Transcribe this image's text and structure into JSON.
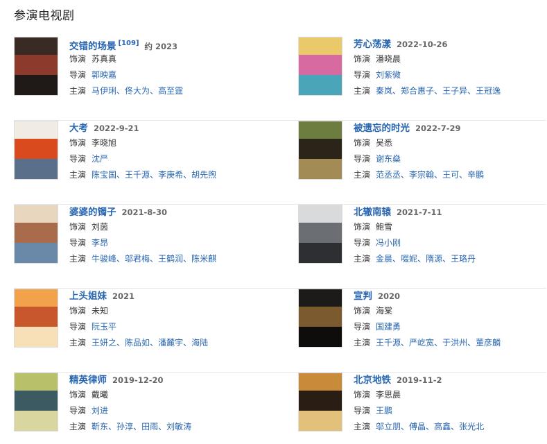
{
  "section_title": "参演电视剧",
  "labels": {
    "role": "饰演",
    "director": "导演",
    "cast": "主演"
  },
  "shows": [
    {
      "title": "交错的场景",
      "ref": "[109]",
      "date": "约 2023",
      "role": "苏真真",
      "director": "郭映嘉",
      "cast": [
        "马伊琍",
        "佟大为",
        "高至霆"
      ],
      "poster_colors": [
        "#3a2a24",
        "#8b3a2c",
        "#1f1a18"
      ]
    },
    {
      "title": "芳心荡漾",
      "ref": "",
      "date": "2022-10-26",
      "role": "潘晓晨",
      "director": "刘紫微",
      "cast": [
        "秦岚",
        "郑合惠子",
        "王子异",
        "王冠逸"
      ],
      "poster_colors": [
        "#e9c96a",
        "#d76aa0",
        "#4aa5b8"
      ]
    },
    {
      "title": "大考",
      "ref": "",
      "date": "2022-9-21",
      "role": "李晓旭",
      "director": "沈严",
      "cast": [
        "陈宝国",
        "王千源",
        "李庚希",
        "胡先煦"
      ],
      "poster_colors": [
        "#f0ece4",
        "#d94a1e",
        "#5a6f8a"
      ]
    },
    {
      "title": "被遗忘的时光",
      "ref": "",
      "date": "2022-7-29",
      "role": "吴悉",
      "director": "谢东燊",
      "cast": [
        "范丞丞",
        "李宗翰",
        "王可",
        "辛鹏"
      ],
      "poster_colors": [
        "#6d7c3f",
        "#2b2418",
        "#a38b55"
      ]
    },
    {
      "title": "婆婆的镯子",
      "ref": "",
      "date": "2021-8-30",
      "role": "刘茵",
      "director": "李昂",
      "cast": [
        "牛骏峰",
        "邬君梅",
        "王鹤润",
        "陈米麒"
      ],
      "poster_colors": [
        "#e8d6bf",
        "#a86b4b",
        "#6a88a8"
      ]
    },
    {
      "title": "北辙南辕",
      "ref": "",
      "date": "2021-7-11",
      "role": "鲍雪",
      "director": "冯小刚",
      "cast": [
        "金晨",
        "啜妮",
        "隋源",
        "王珞丹"
      ],
      "poster_colors": [
        "#d9dadb",
        "#6b6e73",
        "#2e2f33"
      ]
    },
    {
      "title": "上头姐妹",
      "ref": "",
      "date": "2021",
      "role": "未知",
      "director": "阮玉平",
      "cast": [
        "王妍之",
        "陈品如",
        "潘麓宇",
        "海陆"
      ],
      "poster_colors": [
        "#f2a24a",
        "#c9572c",
        "#f7e0b8"
      ]
    },
    {
      "title": "宣判",
      "ref": "",
      "date": "2020",
      "role": "海棠",
      "director": "国建勇",
      "cast": [
        "王千源",
        "严屹宽",
        "于洪州",
        "董彦麟"
      ],
      "poster_colors": [
        "#1c1b19",
        "#7a5a2e",
        "#0e0d0c"
      ]
    },
    {
      "title": "精英律师",
      "ref": "",
      "date": "2019-12-20",
      "role": "戴曦",
      "director": "刘进",
      "cast": [
        "靳东",
        "孙淳",
        "田雨",
        "刘敏涛"
      ],
      "poster_colors": [
        "#b8c06a",
        "#3c5a62",
        "#d9d6a0"
      ]
    },
    {
      "title": "北京地铁",
      "ref": "",
      "date": "2019-11-2",
      "role": "李思晨",
      "director": "王鹏",
      "cast": [
        "邬立朋",
        "傅晶",
        "高鑫",
        "张光北"
      ],
      "poster_colors": [
        "#c98b3a",
        "#2a1e14",
        "#e2c27a"
      ]
    }
  ]
}
